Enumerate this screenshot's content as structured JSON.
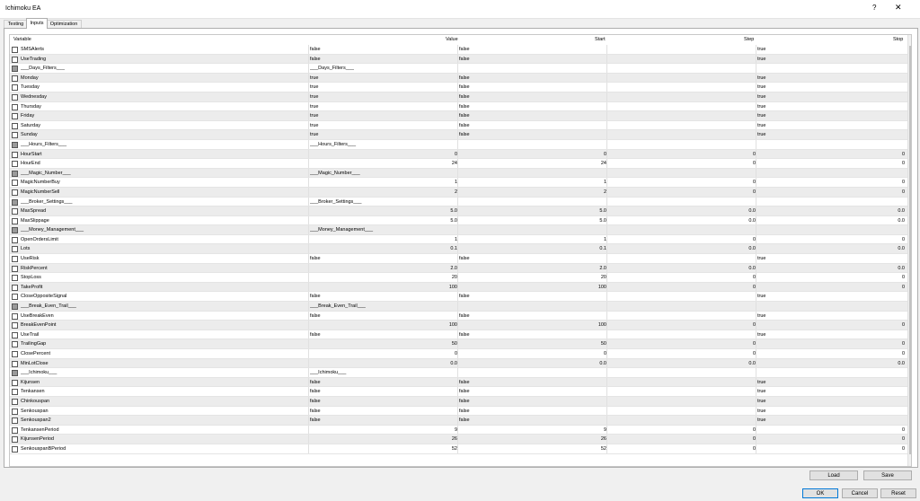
{
  "window": {
    "title": "Ichimoku EA",
    "help": "?",
    "close": "✕"
  },
  "tabs": [
    "Testing",
    "Inputs",
    "Optimization"
  ],
  "columns": [
    "Variable",
    "Value",
    "Start",
    "Step",
    "Stop"
  ],
  "rows": [
    {
      "name": "SMSAlerts",
      "value": "false",
      "start": "false",
      "step": "",
      "stop": "true"
    },
    {
      "name": "UseTrading",
      "value": "false",
      "start": "false",
      "step": "",
      "stop": "true"
    },
    {
      "name": "___Days_Filters___",
      "value": "___Days_Filters___",
      "start": "",
      "step": "",
      "stop": "",
      "section": true
    },
    {
      "name": "Monday",
      "value": "true",
      "start": "false",
      "step": "",
      "stop": "true"
    },
    {
      "name": "Tuesday",
      "value": "true",
      "start": "false",
      "step": "",
      "stop": "true"
    },
    {
      "name": "Wednesday",
      "value": "true",
      "start": "false",
      "step": "",
      "stop": "true"
    },
    {
      "name": "Thursday",
      "value": "true",
      "start": "false",
      "step": "",
      "stop": "true"
    },
    {
      "name": "Friday",
      "value": "true",
      "start": "false",
      "step": "",
      "stop": "true"
    },
    {
      "name": "Saturday",
      "value": "true",
      "start": "false",
      "step": "",
      "stop": "true"
    },
    {
      "name": "Sunday",
      "value": "true",
      "start": "false",
      "step": "",
      "stop": "true"
    },
    {
      "name": "___Hours_Filters___",
      "value": "___Hours_Filters___",
      "start": "",
      "step": "",
      "stop": "",
      "section": true
    },
    {
      "name": "HourStart",
      "value": "0",
      "start": "0",
      "step": "0",
      "stop": "0",
      "num": true
    },
    {
      "name": "HourEnd",
      "value": "24",
      "start": "24",
      "step": "0",
      "stop": "0",
      "num": true
    },
    {
      "name": "___Magic_Number___",
      "value": "___Magic_Number___",
      "start": "",
      "step": "",
      "stop": "",
      "section": true
    },
    {
      "name": "MagicNumberBuy",
      "value": "1",
      "start": "1",
      "step": "0",
      "stop": "0",
      "num": true
    },
    {
      "name": "MagicNumberSell",
      "value": "2",
      "start": "2",
      "step": "0",
      "stop": "0",
      "num": true
    },
    {
      "name": "___Broker_Settings___",
      "value": "___Broker_Settings___",
      "start": "",
      "step": "",
      "stop": "",
      "section": true
    },
    {
      "name": "MaxSpread",
      "value": "5.0",
      "start": "5.0",
      "step": "0.0",
      "stop": "0.0",
      "num": true
    },
    {
      "name": "MaxSlippage",
      "value": "5.0",
      "start": "5.0",
      "step": "0.0",
      "stop": "0.0",
      "num": true
    },
    {
      "name": "___Money_Management___",
      "value": "___Money_Management___",
      "start": "",
      "step": "",
      "stop": "",
      "section": true
    },
    {
      "name": "OpenOrdersLimit",
      "value": "1",
      "start": "1",
      "step": "0",
      "stop": "0",
      "num": true
    },
    {
      "name": "Lots",
      "value": "0.1",
      "start": "0.1",
      "step": "0.0",
      "stop": "0.0",
      "num": true
    },
    {
      "name": "UseRisk",
      "value": "false",
      "start": "false",
      "step": "",
      "stop": "true"
    },
    {
      "name": "RiskPercent",
      "value": "2.0",
      "start": "2.0",
      "step": "0.0",
      "stop": "0.0",
      "num": true
    },
    {
      "name": "StopLoss",
      "value": "20",
      "start": "20",
      "step": "0",
      "stop": "0",
      "num": true
    },
    {
      "name": "TakeProfit",
      "value": "100",
      "start": "100",
      "step": "0",
      "stop": "0",
      "num": true
    },
    {
      "name": "CloseOppositeSignal",
      "value": "false",
      "start": "false",
      "step": "",
      "stop": "true"
    },
    {
      "name": "___Break_Even_Trail___",
      "value": "___Break_Even_Trail___",
      "start": "",
      "step": "",
      "stop": "",
      "section": true
    },
    {
      "name": "UseBreakEven",
      "value": "false",
      "start": "false",
      "step": "",
      "stop": "true"
    },
    {
      "name": "BreakEvenPoint",
      "value": "100",
      "start": "100",
      "step": "0",
      "stop": "0",
      "num": true
    },
    {
      "name": "UseTrail",
      "value": "false",
      "start": "false",
      "step": "",
      "stop": "true"
    },
    {
      "name": "TrailingGap",
      "value": "50",
      "start": "50",
      "step": "0",
      "stop": "0",
      "num": true
    },
    {
      "name": "ClosePercent",
      "value": "0",
      "start": "0",
      "step": "0",
      "stop": "0",
      "num": true
    },
    {
      "name": "MinLotClose",
      "value": "0.0",
      "start": "0.0",
      "step": "0.0",
      "stop": "0.0",
      "num": true
    },
    {
      "name": "___Ichimoku___",
      "value": "___Ichimoku___",
      "start": "",
      "step": "",
      "stop": "",
      "section": true
    },
    {
      "name": "Kijunsen",
      "value": "false",
      "start": "false",
      "step": "",
      "stop": "true"
    },
    {
      "name": "Tenkansen",
      "value": "false",
      "start": "false",
      "step": "",
      "stop": "true"
    },
    {
      "name": "Chinkouspan",
      "value": "false",
      "start": "false",
      "step": "",
      "stop": "true"
    },
    {
      "name": "Senkouspan",
      "value": "false",
      "start": "false",
      "step": "",
      "stop": "true"
    },
    {
      "name": "Senkouspan2",
      "value": "false",
      "start": "false",
      "step": "",
      "stop": "true"
    },
    {
      "name": "TenkansenPeriod",
      "value": "9",
      "start": "9",
      "step": "0",
      "stop": "0",
      "num": true
    },
    {
      "name": "KijunsenPeriod",
      "value": "26",
      "start": "26",
      "step": "0",
      "stop": "0",
      "num": true
    },
    {
      "name": "SenkouspanBPeriod",
      "value": "52",
      "start": "52",
      "step": "0",
      "stop": "0",
      "num": true
    }
  ],
  "buttons": {
    "load": "Load",
    "save": "Save",
    "ok": "OK",
    "cancel": "Cancel",
    "reset": "Reset"
  }
}
